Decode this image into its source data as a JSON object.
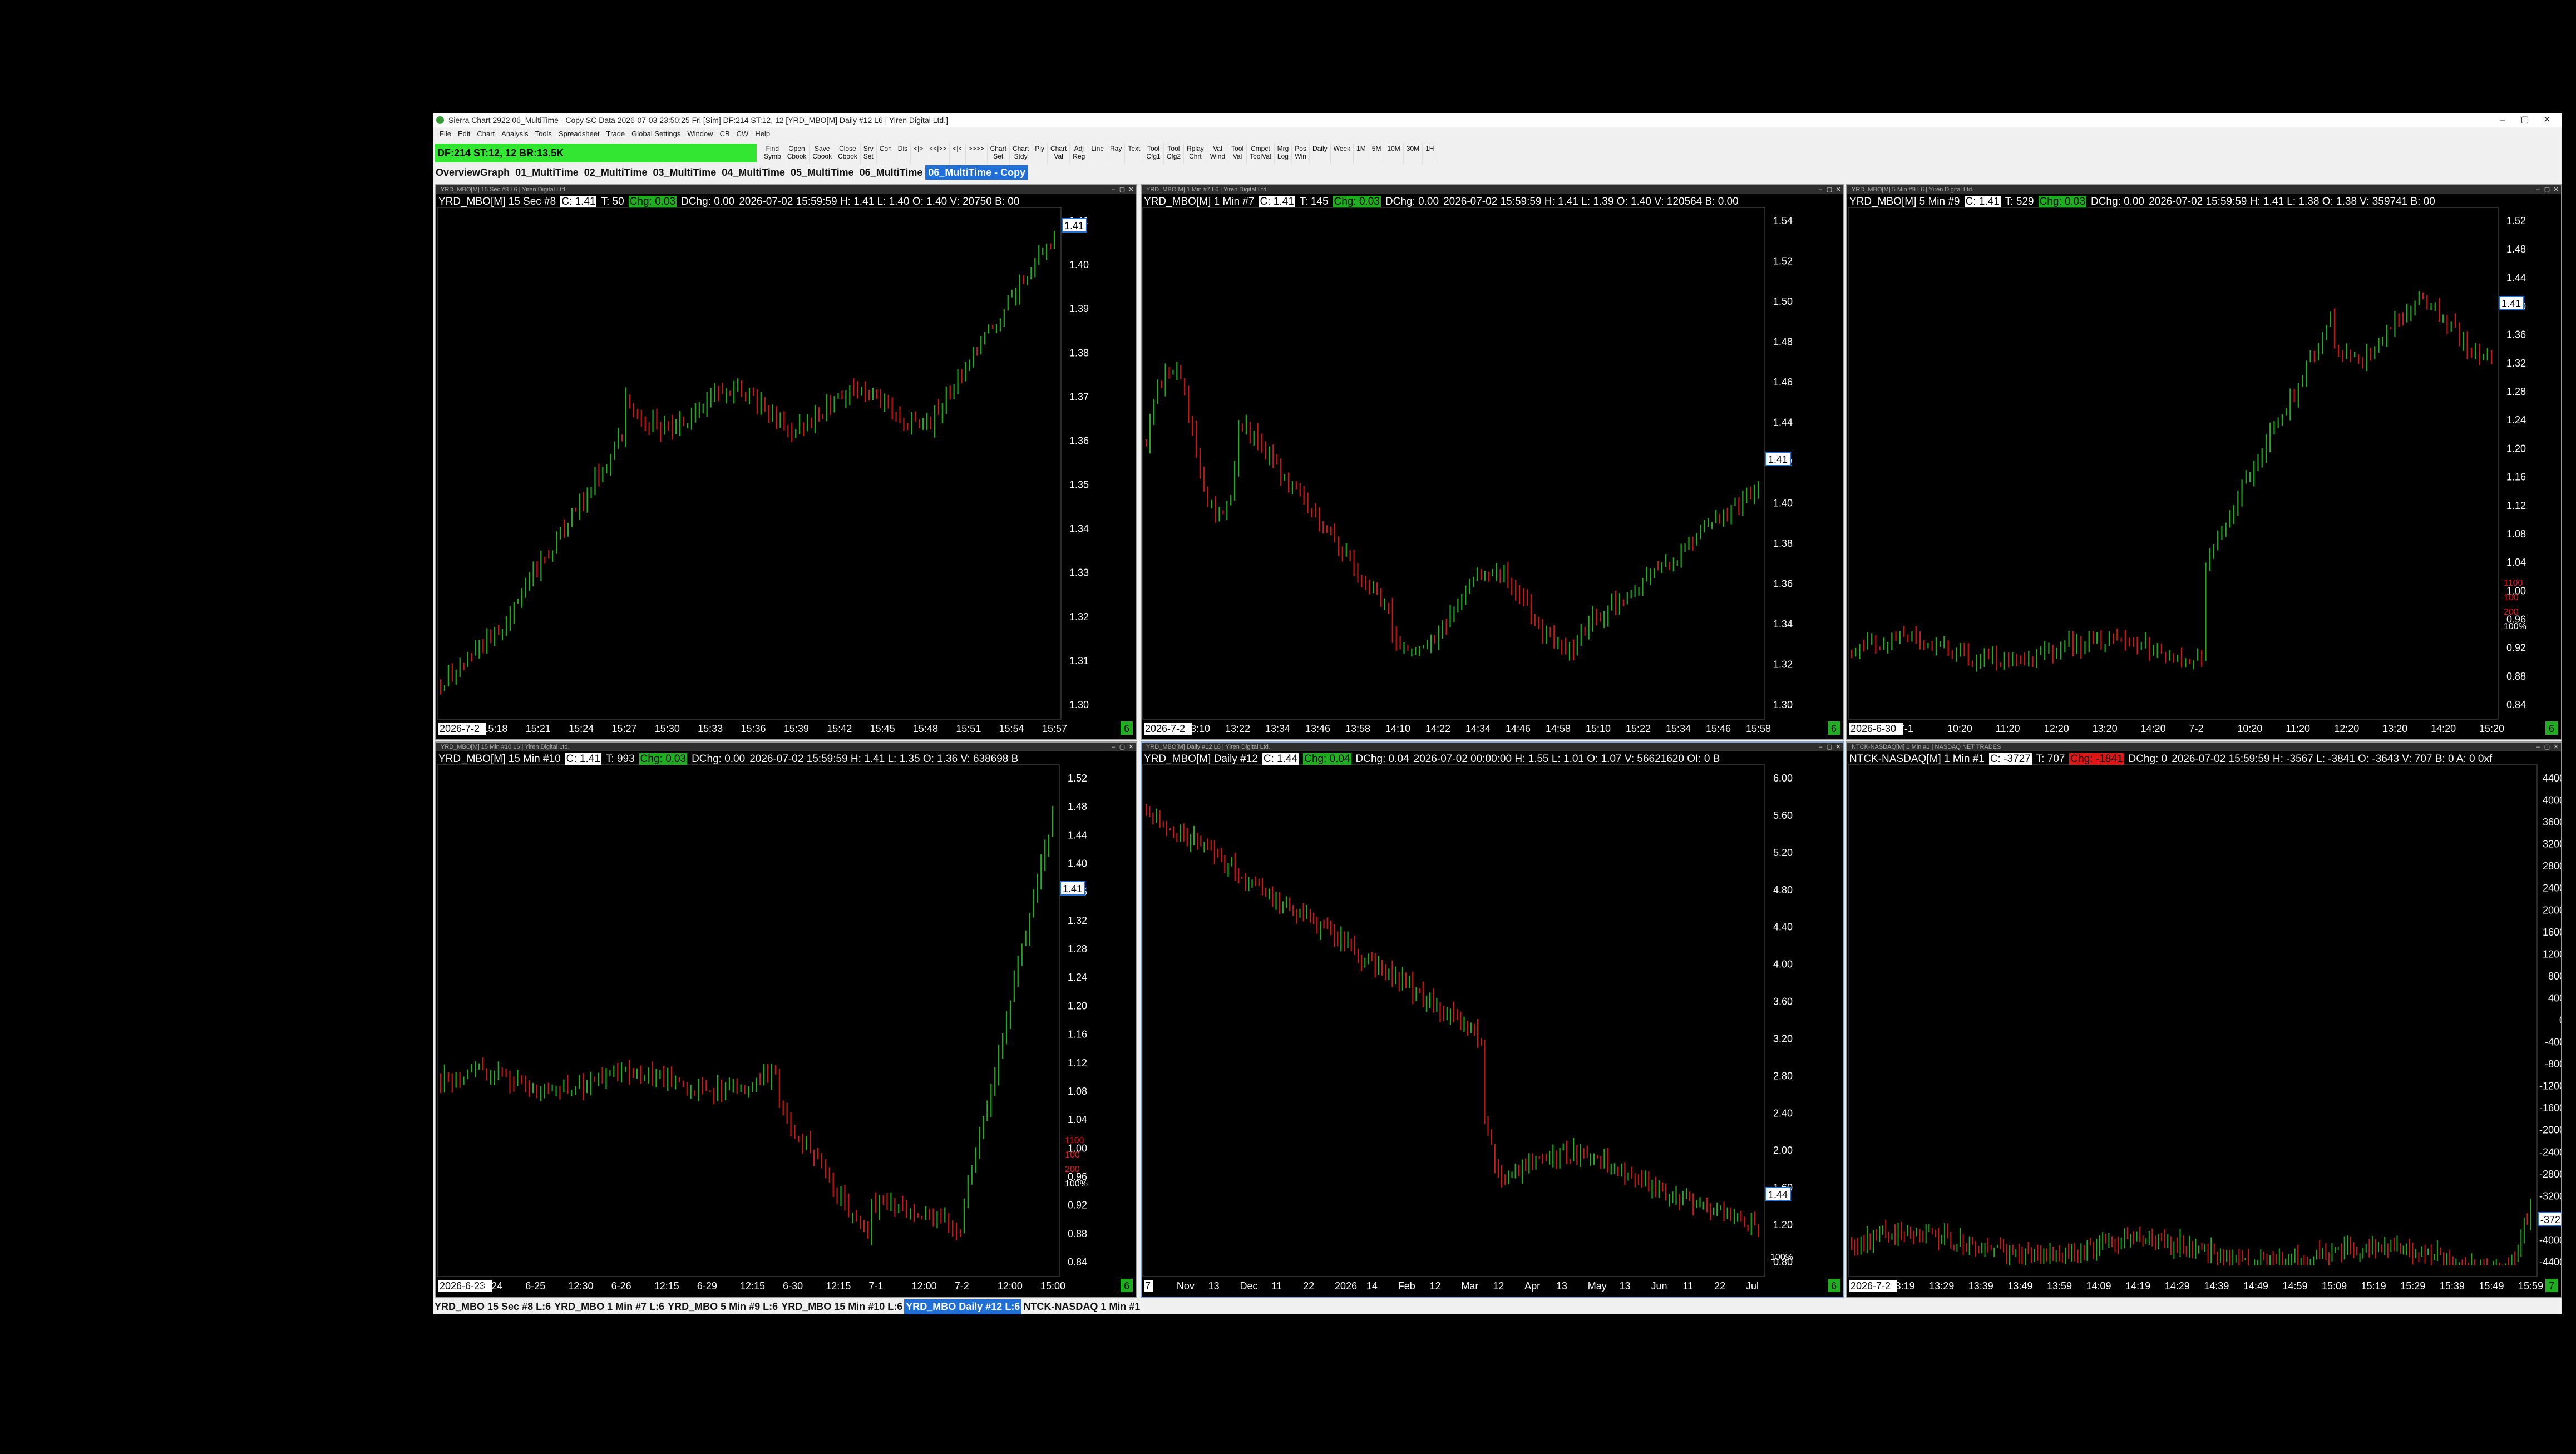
{
  "window": {
    "title": "Sierra Chart 2922 06_MultiTime - Copy SC Data 2026-07-03  23:50:25 Fri [Sim] DF:214  ST:12, 12 [YRD_MBO[M]  Daily #12 L6 | Yiren Digital Ltd.]",
    "controls": [
      "–",
      "▢",
      "✕"
    ]
  },
  "menu": [
    "File",
    "Edit",
    "Chart",
    "Analysis",
    "Tools",
    "Spreadsheet",
    "Trade",
    "Global Settings",
    "Window",
    "CB",
    "CW",
    "Help"
  ],
  "status_box": "DF:214  ST:12, 12   BR:13.5K",
  "toolbar": [
    "Find\nSymb",
    "Open\nCbook",
    "Save\nCbook",
    "Close\nCbook",
    "Srv\nSet",
    "Con",
    "Dis",
    "<|>",
    "<<|>>",
    "<|<",
    ">>>>",
    "Chart\nSet",
    "Chart\nStdy",
    "Ply",
    "Chart\nVal",
    "Adj\nReg",
    "Line",
    "Ray",
    "Text",
    "Tool\nCfg1",
    "Tool\nCfg2",
    "Rplay\nChrt",
    "Val\nWind",
    "Tool\nVal",
    "Cmpct\nToolVal",
    "Mrg\nLog",
    "Pos\nWin",
    "Daily",
    "Week",
    "1M",
    "5M",
    "10M",
    "30M",
    "1H"
  ],
  "chartbook_tabs": [
    "OverviewGraph",
    "01_MultiTime",
    "02_MultiTime",
    "03_MultiTime",
    "04_MultiTime",
    "05_MultiTime",
    "06_MultiTime",
    "06_MultiTime - Copy"
  ],
  "active_tab_index": 7,
  "charts": [
    {
      "title": "YRD_MBO[M]  15 Sec #8 L6 | Yiren Digital Ltd.",
      "symbol": "YRD_MBO[M]  15 Sec  #8",
      "c": "C: 1.41",
      "t": "T: 50",
      "chg": "Chg: 0.03",
      "chg_color": "green",
      "dchg": "DChg: 0.00",
      "ohlc": "2026-07-02 15:59:59  H: 1.41  L: 1.40  O: 1.40  V: 20750  B: 00",
      "price_label": "1.41",
      "y_ticks": [
        "1.41",
        "1.40",
        "1.39",
        "1.38",
        "1.37",
        "1.36",
        "1.35",
        "1.34",
        "1.33",
        "1.32",
        "1.31",
        "1.30"
      ],
      "x_ticks": [
        "2026-7-2",
        "15:18",
        "15:21",
        "15:24",
        "15:27",
        "15:30",
        "15:33",
        "15:36",
        "15:39",
        "15:42",
        "15:45",
        "15:48",
        "15:51",
        "15:54",
        "15:57"
      ],
      "corner": "6"
    },
    {
      "title": "YRD_MBO[M]  1 Min #7 L6 | Yiren Digital Ltd.",
      "symbol": "YRD_MBO[M]  1 Min  #7",
      "c": "C: 1.41",
      "t": "T: 145",
      "chg": "Chg: 0.03",
      "chg_color": "green",
      "dchg": "DChg: 0.00",
      "ohlc": "2026-07-02 15:59:59  H: 1.41  L: 1.39  O: 1.40  V: 120564  B: 0.00",
      "price_label": "1.41",
      "y_ticks": [
        "1.54",
        "1.52",
        "1.50",
        "1.48",
        "1.46",
        "1.44",
        "1.42",
        "1.40",
        "1.38",
        "1.36",
        "1.34",
        "1.32",
        "1.30"
      ],
      "x_ticks": [
        "2026-7-2",
        "13:10",
        "13:22",
        "13:34",
        "13:46",
        "13:58",
        "14:10",
        "14:22",
        "14:34",
        "14:46",
        "14:58",
        "15:10",
        "15:22",
        "15:34",
        "15:46",
        "15:58"
      ],
      "corner": "6"
    },
    {
      "title": "YRD_MBO[M]  5 Min #9 L6 | Yiren Digital Ltd.",
      "symbol": "YRD_MBO[M]  5 Min  #9",
      "c": "C: 1.41",
      "t": "T: 529",
      "chg": "Chg: 0.03",
      "chg_color": "green",
      "dchg": "DChg: 0.00",
      "ohlc": "2026-07-02 15:59:59  H: 1.41  L: 1.38  O: 1.38  V: 359741  B: 00",
      "price_label": "1.41",
      "y_ticks": [
        "1.52",
        "1.48",
        "1.44",
        "1.40",
        "1.36",
        "1.32",
        "1.28",
        "1.24",
        "1.20",
        "1.16",
        "1.12",
        "1.08",
        "1.04",
        "1.00",
        "0.96",
        "0.92",
        "0.88",
        "0.84"
      ],
      "x_ticks": [
        "2026-6-30",
        "7-1",
        "10:20",
        "11:20",
        "12:20",
        "13:20",
        "14:20",
        "7-2",
        "10:20",
        "11:20",
        "12:20",
        "13:20",
        "14:20",
        "15:20"
      ],
      "side_labels": [
        "1100",
        "100",
        "200",
        "100%"
      ],
      "corner": "6"
    },
    {
      "title": "YRD_MBO[M]  15 Min #10 L6 | Yiren Digital Ltd.",
      "symbol": "YRD_MBO[M]  15 Min  #10",
      "c": "C: 1.41",
      "t": "T: 993",
      "chg": "Chg: 0.03",
      "chg_color": "green",
      "dchg": "DChg: 0.00",
      "ohlc": "2026-07-02 15:59:59  H: 1.41  L: 1.35  O: 1.36  V: 638698  B",
      "price_label": "1.41",
      "y_ticks": [
        "1.52",
        "1.48",
        "1.44",
        "1.40",
        "1.36",
        "1.32",
        "1.28",
        "1.24",
        "1.20",
        "1.16",
        "1.12",
        "1.08",
        "1.04",
        "1.00",
        "0.96",
        "0.92",
        "0.88",
        "0.84"
      ],
      "x_ticks": [
        "2026-6-23",
        "6-24",
        "6-25",
        "12:30",
        "6-26",
        "12:15",
        "6-29",
        "12:15",
        "6-30",
        "12:15",
        "7-1",
        "12:00",
        "7-2",
        "12:00",
        "15:00"
      ],
      "side_labels": [
        "1100",
        "100",
        "200",
        "100%"
      ],
      "corner": "6"
    },
    {
      "title": "YRD_MBO[M]  Daily #12 L6 | Yiren Digital Ltd.",
      "symbol": "YRD_MBO[M]  Daily #12",
      "c": "C: 1.44",
      "t": "",
      "chg": "Chg: 0.04",
      "chg_color": "green",
      "dchg": "DChg: 0.04",
      "ohlc": "2026-07-02 00:00:00  H: 1.55  L: 1.01  O: 1.07  V: 56621620  OI: 0  B",
      "price_label": "1.44",
      "y_ticks": [
        "6.00",
        "5.60",
        "5.20",
        "4.80",
        "4.40",
        "4.00",
        "3.60",
        "3.20",
        "2.80",
        "2.40",
        "2.00",
        "1.60",
        "1.20",
        "0.80"
      ],
      "x_ticks": [
        "7",
        "Nov",
        "13",
        "Dec",
        "11",
        "22",
        "2026",
        "14",
        "Feb",
        "12",
        "Mar",
        "12",
        "Apr",
        "13",
        "May",
        "13",
        "Jun",
        "11",
        "22",
        "Jul"
      ],
      "side_labels": [
        "100%"
      ],
      "corner": "6"
    },
    {
      "title": "NTCK-NASDAQ[M]  1 Min #1 | NASDAQ NET TRADES",
      "symbol": "NTCK-NASDAQ[M]  1 Min  #1",
      "c": "C: -3727",
      "t": "T: 707",
      "chg": "Chg: -1841",
      "chg_color": "red",
      "dchg": "DChg: 0",
      "ohlc": "2026-07-02 15:59:59  H: -3567  L: -3841  O: -3643  V: 707  B: 0  A: 0  0xf",
      "price_label": "-3727",
      "y_ticks": [
        "4400",
        "4000",
        "3600",
        "3200",
        "2800",
        "2400",
        "2000",
        "1600",
        "1200",
        "800",
        "400",
        "0",
        "-400",
        "-800",
        "-1200",
        "-1600",
        "-2000",
        "-2400",
        "-2800",
        "-3200",
        "-3600",
        "-4000",
        "-4400"
      ],
      "x_ticks": [
        "2026-7-2",
        "13:19",
        "13:29",
        "13:39",
        "13:49",
        "13:59",
        "14:09",
        "14:19",
        "14:29",
        "14:39",
        "14:49",
        "14:59",
        "15:09",
        "15:19",
        "15:29",
        "15:39",
        "15:49",
        "15:59"
      ],
      "corner": "7"
    }
  ],
  "chartbar": [
    "YRD_MBO   15 Sec  #8 L:6",
    "YRD_MBO   1 Min   #7 L:6",
    "YRD_MBO   5 Min   #9 L:6",
    "YRD_MBO   15 Min   #10 L:6",
    "YRD_MBO   Daily #12 L:6",
    "NTCK-NASDAQ   1 Min   #1"
  ],
  "active_chartbar_index": 4,
  "colors": {
    "up": "#1fae1f",
    "down": "#d01515",
    "status_box": "#32e632",
    "active_tab": "#1f6fd6"
  }
}
